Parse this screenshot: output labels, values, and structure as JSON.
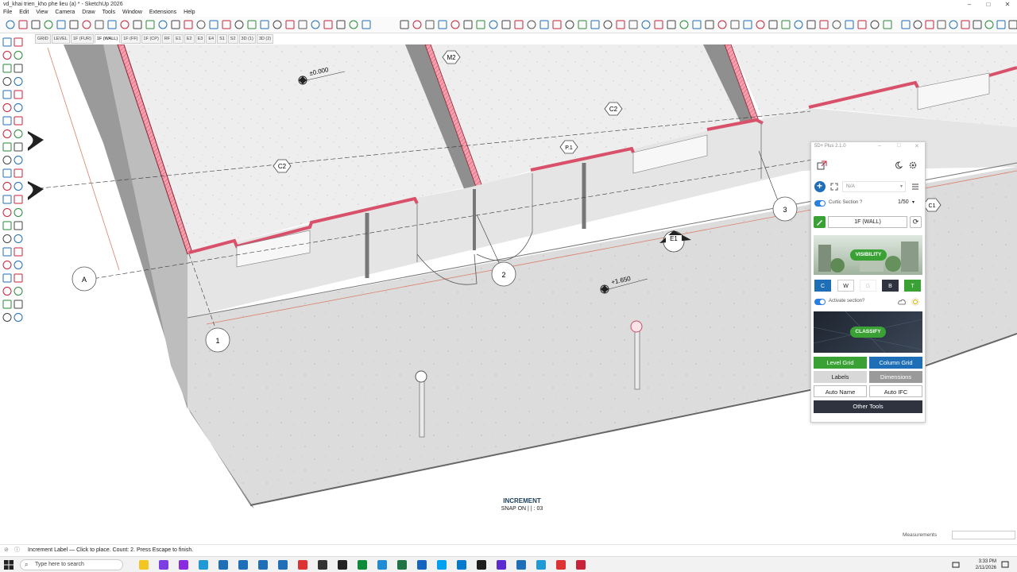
{
  "window": {
    "title": "vd_khai trien_kho phe lieu (a) * - SketchUp 2026",
    "controls": [
      "–",
      "□",
      "✕"
    ]
  },
  "menu": [
    "File",
    "Edit",
    "View",
    "Camera",
    "Draw",
    "Tools",
    "Window",
    "Extensions",
    "Help"
  ],
  "scene_tabs": [
    {
      "label": "GRID",
      "active": false
    },
    {
      "label": "LEVEL",
      "active": false
    },
    {
      "label": "1F (FUR)",
      "active": false
    },
    {
      "label": "1F (WALL)",
      "active": true
    },
    {
      "label": "1F (FF)",
      "active": false
    },
    {
      "label": "1F (CP)",
      "active": false
    },
    {
      "label": "RF",
      "active": false
    },
    {
      "label": "E1",
      "active": false
    },
    {
      "label": "E2",
      "active": false
    },
    {
      "label": "E3",
      "active": false
    },
    {
      "label": "E4",
      "active": false
    },
    {
      "label": "S1",
      "active": false
    },
    {
      "label": "S2",
      "active": false
    },
    {
      "label": "3D (1)",
      "active": false
    },
    {
      "label": "3D (2)",
      "active": false
    }
  ],
  "viewport": {
    "labels": {
      "level_0": "±0.000",
      "level_1": "+1.650",
      "tag_m2": "M2",
      "tag_c2a": "C2",
      "tag_c2b": "C2",
      "tag_p1": "P.1",
      "tag_e1": "E1",
      "tag_c1": "C1",
      "grid_a": "A",
      "grid_1": "1",
      "grid_2": "2",
      "grid_3": "3"
    },
    "increment_label": "INCREMENT",
    "snap_text": "SNAP ON |  | : 03"
  },
  "panel": {
    "title": "5D+ Plus 2.1.0",
    "dropdown_value": "N/A",
    "curtic_section_label": "Curtic Section ?",
    "scale_value": "1/50",
    "section_name": "1F (WALL)",
    "visibility_label": "VISIBILITY",
    "cw_buttons": [
      "C",
      "W",
      "G",
      "B",
      "T"
    ],
    "activate_section_label": "Activate section?",
    "classify_label": "CLASSIFY",
    "buttons": {
      "level_grid": "Level Grid",
      "column_grid": "Column Grid",
      "labels": "Labels",
      "dimensions": "Dimensions",
      "auto_name": "Auto Name",
      "auto_ifc": "Auto IFC",
      "other_tools": "Other Tools"
    }
  },
  "status": {
    "message": "Increment Label — Click to place. Count: 2. Press Escape to finish.",
    "measurements_label": "Measurements"
  },
  "taskbar": {
    "search_placeholder": "Type here to search",
    "time": "3:33 PM",
    "date": "2/11/2026"
  },
  "colors": {
    "accent_blue": "#1f6fb8",
    "accent_green": "#3aa135",
    "dark_button": "#2f3340",
    "wall_cut": "#f28a9a"
  }
}
